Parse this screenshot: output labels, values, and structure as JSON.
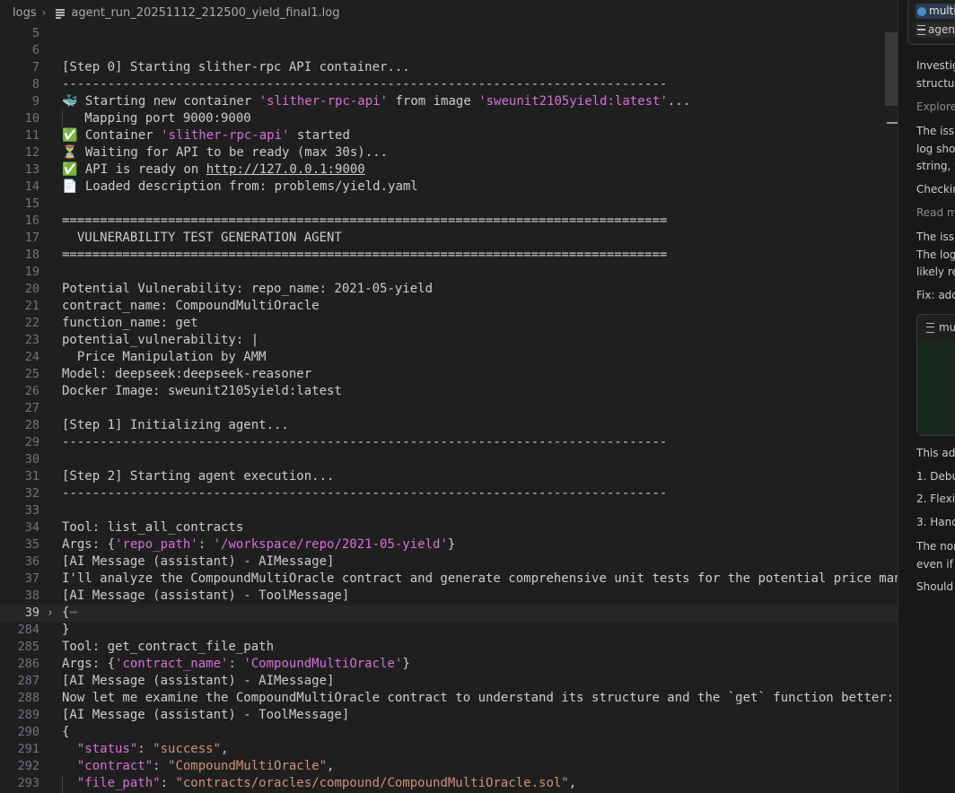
{
  "breadcrumb": {
    "folder": "logs",
    "file": "agent_run_20251112_212500_yield_final1.log"
  },
  "editor": {
    "lines": [
      {
        "n": "5",
        "t": ""
      },
      {
        "n": "6",
        "t": ""
      },
      {
        "n": "7",
        "t": "[Step 0] Starting slither-rpc API container..."
      },
      {
        "n": "8",
        "t": "--------------------------------------------------------------------------------"
      },
      {
        "n": "9",
        "a": "🐳 Starting new container ",
        "b": "'slither-rpc-api'",
        "c": " from image ",
        "d": "'sweunit2105yield:latest'",
        "e": "..."
      },
      {
        "n": "10",
        "t": "   Mapping port 9000:9000"
      },
      {
        "n": "11",
        "a": "✅ Container ",
        "b": "'slither-rpc-api'",
        "c": " started"
      },
      {
        "n": "12",
        "t": "⏳ Waiting for API to be ready (max 30s)..."
      },
      {
        "n": "13",
        "a": "✅ API is ready on ",
        "url": "http://127.0.0.1:9000"
      },
      {
        "n": "14",
        "t": "📄 Loaded description from: problems/yield.yaml"
      },
      {
        "n": "15",
        "t": ""
      },
      {
        "n": "16",
        "t": "================================================================================"
      },
      {
        "n": "17",
        "t": "  VULNERABILITY TEST GENERATION AGENT"
      },
      {
        "n": "18",
        "t": "================================================================================"
      },
      {
        "n": "19",
        "t": ""
      },
      {
        "n": "20",
        "t": "Potential Vulnerability: repo_name: 2021-05-yield"
      },
      {
        "n": "21",
        "t": "contract_name: CompoundMultiOracle"
      },
      {
        "n": "22",
        "t": "function_name: get"
      },
      {
        "n": "23",
        "t": "potential_vulnerability: |"
      },
      {
        "n": "24",
        "t": "  Price Manipulation by AMM"
      },
      {
        "n": "25",
        "t": "Model: deepseek:deepseek-reasoner"
      },
      {
        "n": "26",
        "t": "Docker Image: sweunit2105yield:latest"
      },
      {
        "n": "27",
        "t": ""
      },
      {
        "n": "28",
        "t": "[Step 1] Initializing agent..."
      },
      {
        "n": "29",
        "t": "--------------------------------------------------------------------------------"
      },
      {
        "n": "30",
        "t": ""
      },
      {
        "n": "31",
        "t": "[Step 2] Starting agent execution..."
      },
      {
        "n": "32",
        "t": "--------------------------------------------------------------------------------"
      },
      {
        "n": "33",
        "t": ""
      },
      {
        "n": "34",
        "t": "Tool: list_all_contracts"
      },
      {
        "n": "35",
        "a": "Args: {",
        "b": "'repo_path'",
        "c": ": ",
        "d": "'/workspace/repo/2021-05-yield'",
        "e": "}"
      },
      {
        "n": "36",
        "t": "[AI Message (assistant) - AIMessage]"
      },
      {
        "n": "37",
        "t": "I'll analyze the CompoundMultiOracle contract and generate comprehensive unit tests for the potential price manipulation"
      },
      {
        "n": "38",
        "t": "[AI Message (assistant) - ToolMessage]"
      },
      {
        "n": "39",
        "t": "{",
        "fold": "›",
        "ph": "⋯",
        "current": true
      },
      {
        "n": "284",
        "t": "}"
      },
      {
        "n": "285",
        "t": "Tool: get_contract_file_path"
      },
      {
        "n": "286",
        "a": "Args: {",
        "b": "'contract_name'",
        "c": ": ",
        "d": "'CompoundMultiOracle'",
        "e": "}"
      },
      {
        "n": "287",
        "t": "[AI Message (assistant) - AIMessage]"
      },
      {
        "n": "288",
        "t": "Now let me examine the CompoundMultiOracle contract to understand its structure and the `get` function better:"
      },
      {
        "n": "289",
        "t": "[AI Message (assistant) - ToolMessage]"
      },
      {
        "n": "290",
        "t": "{"
      },
      {
        "n": "291",
        "k": "  \"status\"",
        "s": "\"success\"",
        "e": ","
      },
      {
        "n": "292",
        "k": "  \"contract\"",
        "s": "\"CompoundMultiOracle\"",
        "e": ","
      },
      {
        "n": "293",
        "k": "  \"file_path\"",
        "s": "\"contracts/oracles/compound/CompoundMultiOracle.sol\"",
        "e": ","
      }
    ]
  },
  "chat": {
    "chip1": "multi",
    "chip2": "agent",
    "p1": "Investig",
    "p2": "structu",
    "p3": "Explore",
    "p4": "The issu",
    "p5": "log sho",
    "p6": "string, v",
    "p7": "Checkin",
    "p8": "Read m",
    "p9": "The issu",
    "p10": "The log",
    "p11": "likely re",
    "p12": "Fix: add",
    "codebox_file": "mu",
    "p13": "This add",
    "li1": "1. Debu",
    "li2": "2. Flexi",
    "li3": "3. Hand",
    "p14": "The nor",
    "p15": "even if",
    "p16": "Should"
  }
}
